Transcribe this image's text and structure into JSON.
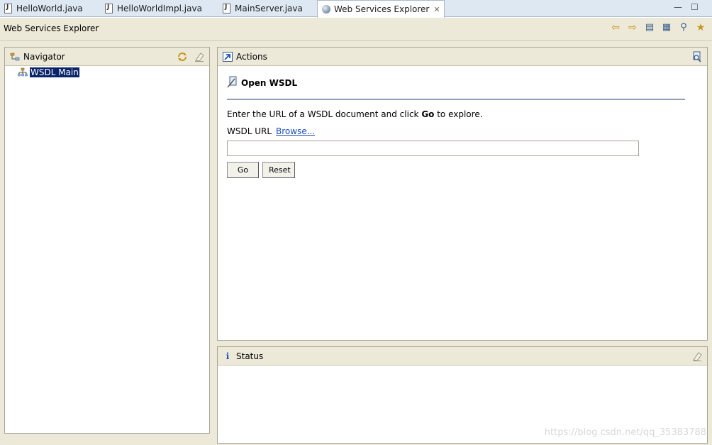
{
  "tabs": [
    {
      "label": "HelloWorld.java",
      "icon": "java-file-icon",
      "active": false
    },
    {
      "label": "HelloWorldImpl.java",
      "icon": "java-file-icon",
      "active": false
    },
    {
      "label": "MainServer.java",
      "icon": "java-file-icon",
      "active": false
    },
    {
      "label": "Web Services Explorer",
      "icon": "globe-icon",
      "active": true,
      "close": "✕"
    }
  ],
  "window": {
    "minimize": "—",
    "maximize": "☐"
  },
  "title": "Web Services Explorer",
  "toolbar": {
    "icons": [
      "back-icon",
      "forward-icon",
      "page-icon",
      "favorites-page-icon",
      "wsdl-search-icon",
      "star-icon"
    ],
    "glyphs": [
      "⇦",
      "⇨",
      "▤",
      "▦",
      "⚲",
      "★"
    ]
  },
  "navigator": {
    "title": "Navigator",
    "tree": [
      {
        "label": "WSDL Main",
        "selected": true
      }
    ]
  },
  "actions": {
    "title": "Actions",
    "section_title": "Open WSDL",
    "description_before": "Enter the URL of a WSDL document and click ",
    "description_bold": "Go",
    "description_after": " to explore.",
    "url_label": "WSDL URL",
    "browse_link": "Browse...",
    "url_value": "",
    "go_button": "Go",
    "reset_button": "Reset"
  },
  "status": {
    "title": "Status",
    "info_glyph": "i"
  },
  "watermark": "https://blog.csdn.net/qq_35383788",
  "colors": {
    "selection": "#0a246a",
    "link": "#1c4fb5",
    "panel_bg": "#ece9d8",
    "tab_bar": "#dde8f3"
  }
}
